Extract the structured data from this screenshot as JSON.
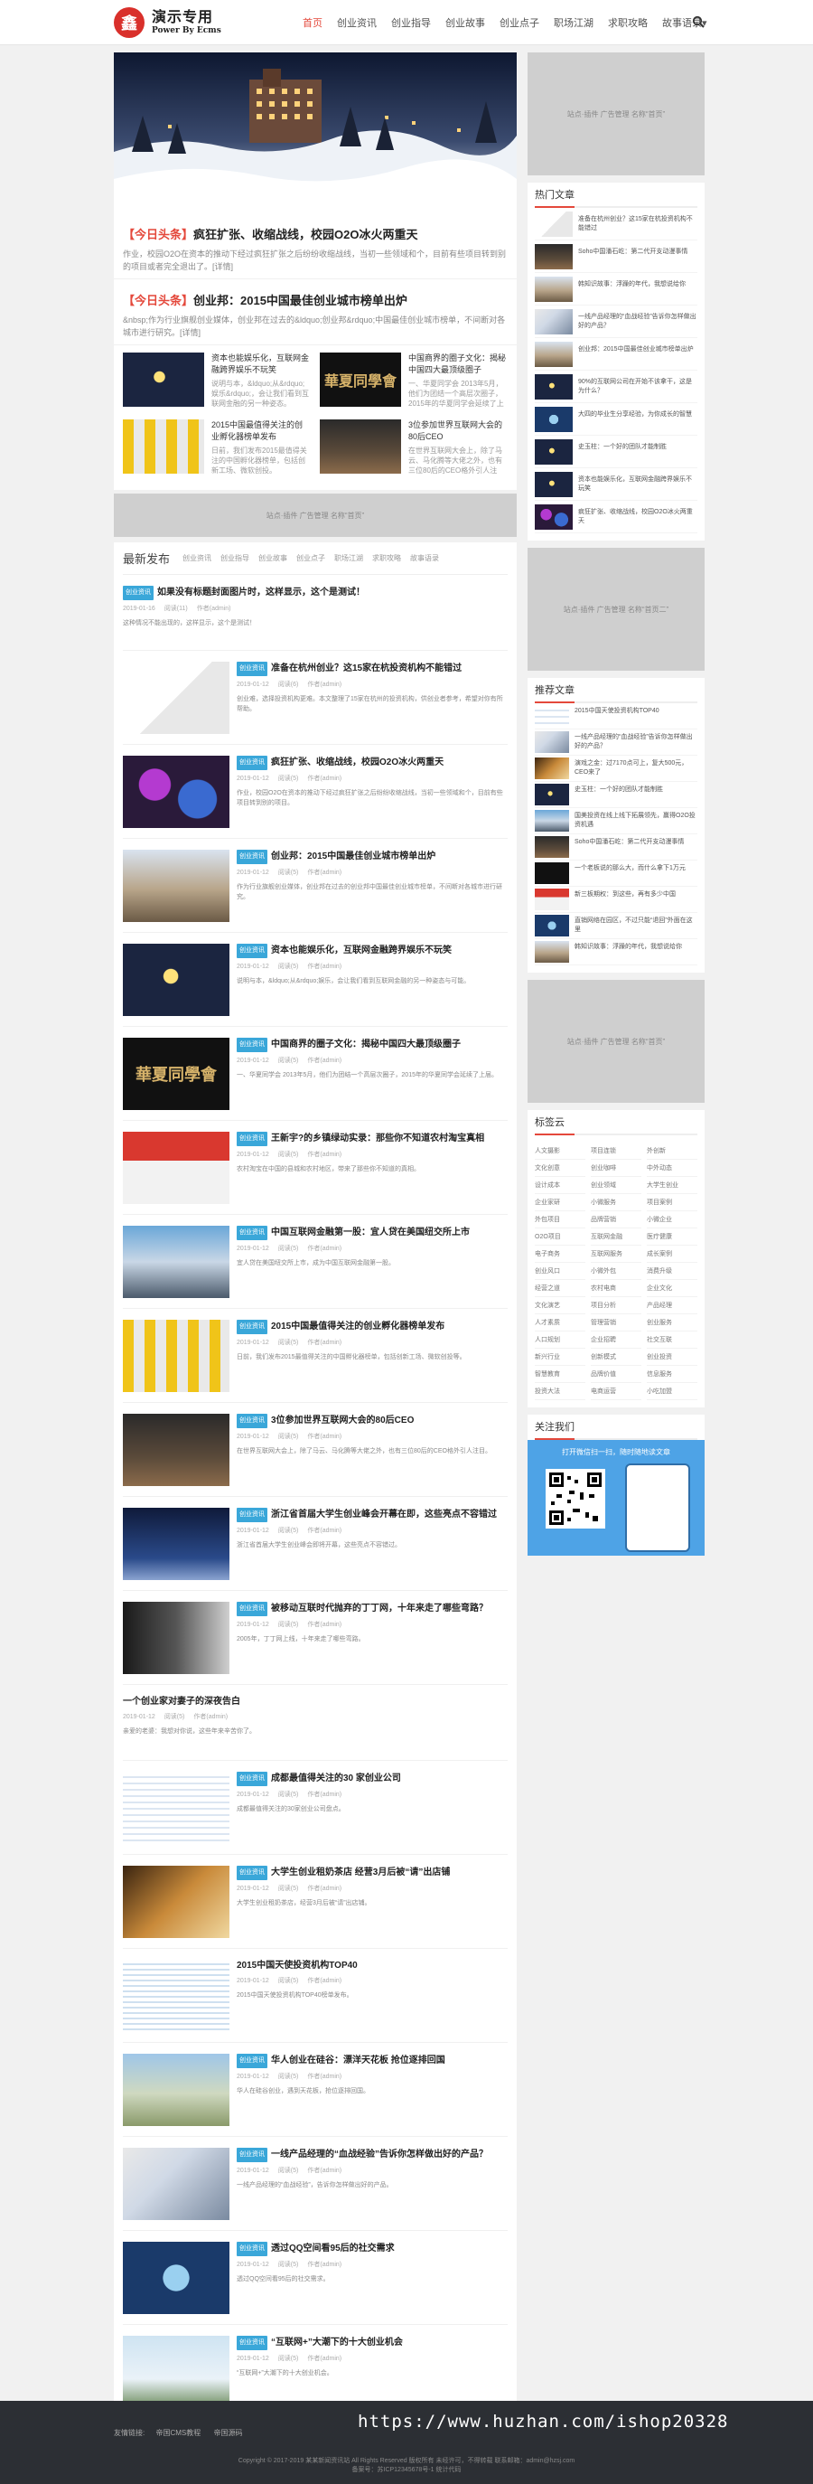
{
  "site": {
    "logo_title": "演示专用",
    "logo_sub": "Power By Ecms",
    "logo_mark": "鑫"
  },
  "nav": [
    "首页",
    "创业资讯",
    "创业指导",
    "创业故事",
    "创业点子",
    "职场江湖",
    "求职攻略",
    "故事语录▾"
  ],
  "headlines": [
    {
      "tag": "【今日头条】",
      "title": "疯狂扩张、收缩战线，校园O2O冰火两重天",
      "desc": "作业，校园O2O在资本的推动下经过疯狂扩张之后纷纷收缩战线，当初一些领域和个，目前有些项目转到别的项目或者完全退出了。[详情]"
    },
    {
      "tag": "【今日头条】",
      "title": "创业邦：2015中国最佳创业城市榜单出炉",
      "desc": "&nbsp;作为行业旗舰创业媒体，创业邦在过去的&ldquo;创业邦&rdquo;中国最佳创业城市榜单，不间断对各城市进行研究。[详情]"
    }
  ],
  "features": [
    {
      "title": "资本也能娱乐化，互联网金融跨界娱乐不玩笑",
      "desc": "说明与本，&ldquo;从&rdquo;娱乐&rdquo;，会让我们看到互联网金融的另一种姿态。"
    },
    {
      "title": "中国商界的圈子文化：揭秘中国四大最顶级圈子",
      "desc": "一、华夏同学会 2013年5月，他们为团结一个高层次圈子，2015年的华夏同学会延续了上届。"
    },
    {
      "title": "2015中国最值得关注的创业孵化器榜单发布",
      "desc": "日前，我们发布2015最值得关注的中国孵化器榜单，包括创新工场、微软创投。"
    },
    {
      "title": "3位参加世界互联网大会的80后CEO",
      "desc": "在世界互联网大会上，除了马云、马化腾等大佬之外，也有三位80后的CEO格外引人注目。"
    }
  ],
  "ads": {
    "middle": "站点·插件 广告管理 名称“首页”",
    "side1": "站点·插件 广告管理 名称“首页”",
    "side2": "站点·插件 广告管理 名称“首页二”",
    "side3": "站点·插件 广告管理 名称“首页”"
  },
  "latest": {
    "title": "最新发布",
    "tabs": [
      "创业资讯",
      "创业指导",
      "创业故事",
      "创业点子",
      "职场江湖",
      "求职攻略",
      "故事语录"
    ],
    "posts": [
      {
        "img": false,
        "cat": "创业资讯",
        "title": "如果没有标题封面图片时，这样显示，这个是测试！",
        "date": "2019-01-16",
        "views": "阅读(11)",
        "author": "作者(admin)",
        "excerpt": "这种情况不能出现的，这样显示，这个是测试！"
      },
      {
        "img": true,
        "thumb": "startup",
        "cat": "创业资讯",
        "title": "准备在杭州创业？这15家在杭投资机构不能错过",
        "date": "2019-01-12",
        "views": "阅读(6)",
        "author": "作者(admin)",
        "excerpt": "创业难，选择投资机构更难。本文整理了15家在杭州的投资机构，供创业者参考，希望对你有所帮助。"
      },
      {
        "img": true,
        "thumb": "crowd",
        "cat": "创业资讯",
        "title": "疯狂扩张、收缩战线，校园O2O冰火两重天",
        "date": "2019-01-12",
        "views": "阅读(5)",
        "author": "作者(admin)",
        "excerpt": "作业，校园O2O在资本的推动下经过疯狂扩张之后纷纷收缩战线，当初一些领域和个，目前有些项目转到别的项目。"
      },
      {
        "img": true,
        "thumb": "city",
        "cat": "创业资讯",
        "title": "创业邦：2015中国最佳创业城市榜单出炉",
        "date": "2019-01-12",
        "views": "阅读(5)",
        "author": "作者(admin)",
        "excerpt": "作为行业旗舰创业媒体，创业邦在过去的创业邦中国最佳创业城市榜单，不间断对各城市进行研究。"
      },
      {
        "img": true,
        "thumb": "star",
        "cat": "创业资讯",
        "title": "资本也能娱乐化，互联网金融跨界娱乐不玩笑",
        "date": "2019-01-12",
        "views": "阅读(5)",
        "author": "作者(admin)",
        "excerpt": "说明与本，&ldquo;从&rdquo;娱乐，会让我们看到互联网金融的另一种姿态与可能。"
      },
      {
        "img": true,
        "thumb": "alumni",
        "cat": "创业资讯",
        "title": "中国商界的圈子文化：揭秘中国四大最顶级圈子",
        "date": "2019-01-12",
        "views": "阅读(5)",
        "author": "作者(admin)",
        "excerpt": "一、华夏同学会 2013年5月，他们为团结一个高层次圈子，2015年的华夏同学会延续了上届。"
      },
      {
        "img": true,
        "thumb": "village",
        "cat": "创业资讯",
        "title": "王新宇?的乡镇绿动实录：那些你不知道农村淘宝真相",
        "date": "2019-01-12",
        "views": "阅读(5)",
        "author": "作者(admin)",
        "excerpt": "农村淘宝在中国的县城和农村地区，带来了那些你不知道的真相。"
      },
      {
        "img": true,
        "thumb": "street",
        "cat": "创业资讯",
        "title": "中国互联网金融第一股：宜人贷在美国纽交所上市",
        "date": "2019-01-12",
        "views": "阅读(5)",
        "author": "作者(admin)",
        "excerpt": "宜人贷在美国纽交所上市，成为中国互联网金融第一股。"
      },
      {
        "img": true,
        "thumb": "chart",
        "cat": "创业资讯",
        "title": "2015中国最值得关注的创业孵化器榜单发布",
        "date": "2019-01-12",
        "views": "阅读(5)",
        "author": "作者(admin)",
        "excerpt": "日前，我们发布2015最值得关注的中国孵化器榜单，包括创新工场、微软创投等。"
      },
      {
        "img": true,
        "thumb": "ceo",
        "cat": "创业资讯",
        "title": "3位参加世界互联网大会的80后CEO",
        "date": "2019-01-12",
        "views": "阅读(5)",
        "author": "作者(admin)",
        "excerpt": "在世界互联网大会上，除了马云、马化腾等大佬之外，也有三位80后的CEO格外引人注目。"
      },
      {
        "img": true,
        "thumb": "stage",
        "cat": "创业资讯",
        "title": "浙江省首届大学生创业峰会开幕在即，这些亮点不容错过",
        "date": "2019-01-12",
        "views": "阅读(5)",
        "author": "作者(admin)",
        "excerpt": "浙江省首届大学生创业峰会即将开幕，这些亮点不容错过。"
      },
      {
        "img": true,
        "thumb": "office",
        "cat": "创业资讯",
        "title": "被移动互联时代抛弃的丁丁网，十年来走了哪些弯路？",
        "date": "2019-01-12",
        "views": "阅读(5)",
        "author": "作者(admin)",
        "excerpt": "2005年，丁丁网上线，十年来走了哪些弯路。"
      },
      {
        "img": false,
        "cat": "",
        "title": "一个创业家对妻子的深夜告白",
        "date": "2019-01-12",
        "views": "阅读(5)",
        "author": "作者(admin)",
        "excerpt": "亲爱的老婆：我想对你说，这些年来辛苦你了。"
      },
      {
        "img": true,
        "thumb": "table",
        "cat": "创业资讯",
        "title": "成都最值得关注的30 家创业公司",
        "date": "2019-01-12",
        "views": "阅读(5)",
        "author": "作者(admin)",
        "excerpt": "成都最值得关注的30家创业公司盘点。"
      },
      {
        "img": true,
        "thumb": "tea",
        "cat": "创业资讯",
        "title": "大学生创业租奶茶店 经营3月后被“请”出店铺",
        "date": "2019-01-12",
        "views": "阅读(5)",
        "author": "作者(admin)",
        "excerpt": "大学生创业租奶茶店，经营3月后被“请”出店铺。"
      },
      {
        "img": true,
        "thumb": "list",
        "cat": "",
        "title": "2015中国天使投资机构TOP40",
        "date": "2019-01-12",
        "views": "阅读(5)",
        "author": "作者(admin)",
        "excerpt": "2015中国天使投资机构TOP40榜单发布。"
      },
      {
        "img": true,
        "thumb": "land",
        "cat": "创业资讯",
        "title": "华人创业在硅谷：漂洋天花板 抢位逐排回国",
        "date": "2019-01-12",
        "views": "阅读(5)",
        "author": "作者(admin)",
        "excerpt": "华人在硅谷创业，遇到天花板，抢位逐排回国。"
      },
      {
        "img": true,
        "thumb": "board",
        "cat": "创业资讯",
        "title": "一线产品经理的“血战经验”告诉你怎样做出好的产品？",
        "date": "2019-01-12",
        "views": "阅读(5)",
        "author": "作者(admin)",
        "excerpt": "一线产品经理的“血战经验”，告诉你怎样做出好的产品。"
      },
      {
        "img": true,
        "thumb": "social",
        "cat": "创业资讯",
        "title": "透过QQ空间看95后的社交需求",
        "date": "2019-01-12",
        "views": "阅读(5)",
        "author": "作者(admin)",
        "excerpt": "透过QQ空间看95后的社交需求。"
      },
      {
        "img": true,
        "thumb": "plane",
        "cat": "创业资讯",
        "title": "“互联网+”大潮下的十大创业机会",
        "date": "2019-01-12",
        "views": "阅读(5)",
        "author": "作者(admin)",
        "excerpt": "“互联网+”大潮下的十大创业机会。"
      }
    ]
  },
  "hot": {
    "title": "热门文章",
    "items": [
      {
        "thumb": "startup",
        "text": "准备在杭州创业？这15家在杭投资机构不能错过"
      },
      {
        "thumb": "ceo",
        "text": "Soho中国潘石屹：第二代开支动漫事情"
      },
      {
        "thumb": "city",
        "text": "韩知识故事：浮躁的年代，我想说给你"
      },
      {
        "thumb": "board",
        "text": "一线产品经理的“血战经验”告诉你怎样做出好的产品？"
      },
      {
        "thumb": "city",
        "text": "创业邦：2015中国最佳创业城市榜单出炉"
      },
      {
        "thumb": "star",
        "text": "90%的互联网公司在开始不该拿干，这是为什么？"
      },
      {
        "thumb": "social",
        "text": "大四的毕业生分享经验，为你成长的智慧"
      },
      {
        "thumb": "star",
        "text": "史玉柱：一个好的团队才能制胜"
      },
      {
        "thumb": "star",
        "text": "资本也能娱乐化，互联网金融跨界娱乐不玩笑"
      },
      {
        "thumb": "crowd",
        "text": "疯狂扩张、收缩战线，校园O2O冰火两重天"
      }
    ]
  },
  "recommend": {
    "title": "推荐文章",
    "items": [
      {
        "thumb": "table",
        "text": "2015中国天使投资机构TOP40"
      },
      {
        "thumb": "board",
        "text": "一线产品经理的“血战经验”告诉你怎样做出好的产品？"
      },
      {
        "thumb": "tea",
        "text": "演戏之金：过7170点可上，复大500元，CEO来了"
      },
      {
        "thumb": "star",
        "text": "史玉柱：一个好的团队才能制胜"
      },
      {
        "thumb": "street",
        "text": "国美投资在线上线下拓展领先，赢得O2O投资机遇"
      },
      {
        "thumb": "ceo",
        "text": "Soho中国潘石屹：第二代开支动漫事情"
      },
      {
        "thumb": "alumni",
        "text": "一个老板说的那么大，而什么拿下1万元"
      },
      {
        "thumb": "village",
        "text": "新三板期权：到这些，再有多少中国"
      },
      {
        "thumb": "social",
        "text": "直销网络在园区，不过只能“退回”外面在这里"
      },
      {
        "thumb": "city",
        "text": "韩知识故事：浮躁的年代，我想说给你"
      }
    ]
  },
  "tags": {
    "title": "标签云",
    "items": [
      "人文摄影",
      "项目连锁",
      "外创新",
      "文化创意",
      "创业咖啡",
      "中外动态",
      "设计成本",
      "创业领域",
      "大学生创业",
      "企业家研",
      "小微服务",
      "项目案例",
      "外包项目",
      "品牌营销",
      "小微企业",
      "O2O项目",
      "互联网金融",
      "医疗健康",
      "电子商务",
      "互联网服务",
      "成长案例",
      "创业风口",
      "小微外包",
      "消费升级",
      "经营之道",
      "农村电商",
      "企业文化",
      "文化演艺",
      "项目分析",
      "产品经理",
      "人才素质",
      "管理营销",
      "创业服务",
      "人口规划",
      "企业招聘",
      "社交互联",
      "新兴行业",
      "创新模式",
      "创业投资",
      "智慧教育",
      "品牌价值",
      "信息服务",
      "投资大法",
      "电商运营",
      "小吃加盟"
    ]
  },
  "follow": {
    "title": "关注我们",
    "text": "打开微信扫一扫，随时随地读文章"
  },
  "footer": {
    "links": [
      "友情链接:",
      "帝国CMS教程",
      "帝国源码"
    ],
    "copyright": "Copyright © 2017-2019 某某新闻资讯站 All Rights Reserved 版权所有 未经许可，不得转载 联系邮箱：admin@hzsj.com",
    "icp": "备案号：苏ICP12345678号-1 统计代码"
  },
  "watermark": "https://www.huzhan.com/ishop20328",
  "colors": {
    "accent": "#e4483b",
    "badge": "#3aa7d9",
    "footer": "#2c2f34",
    "follow": "#4ea3e6"
  }
}
